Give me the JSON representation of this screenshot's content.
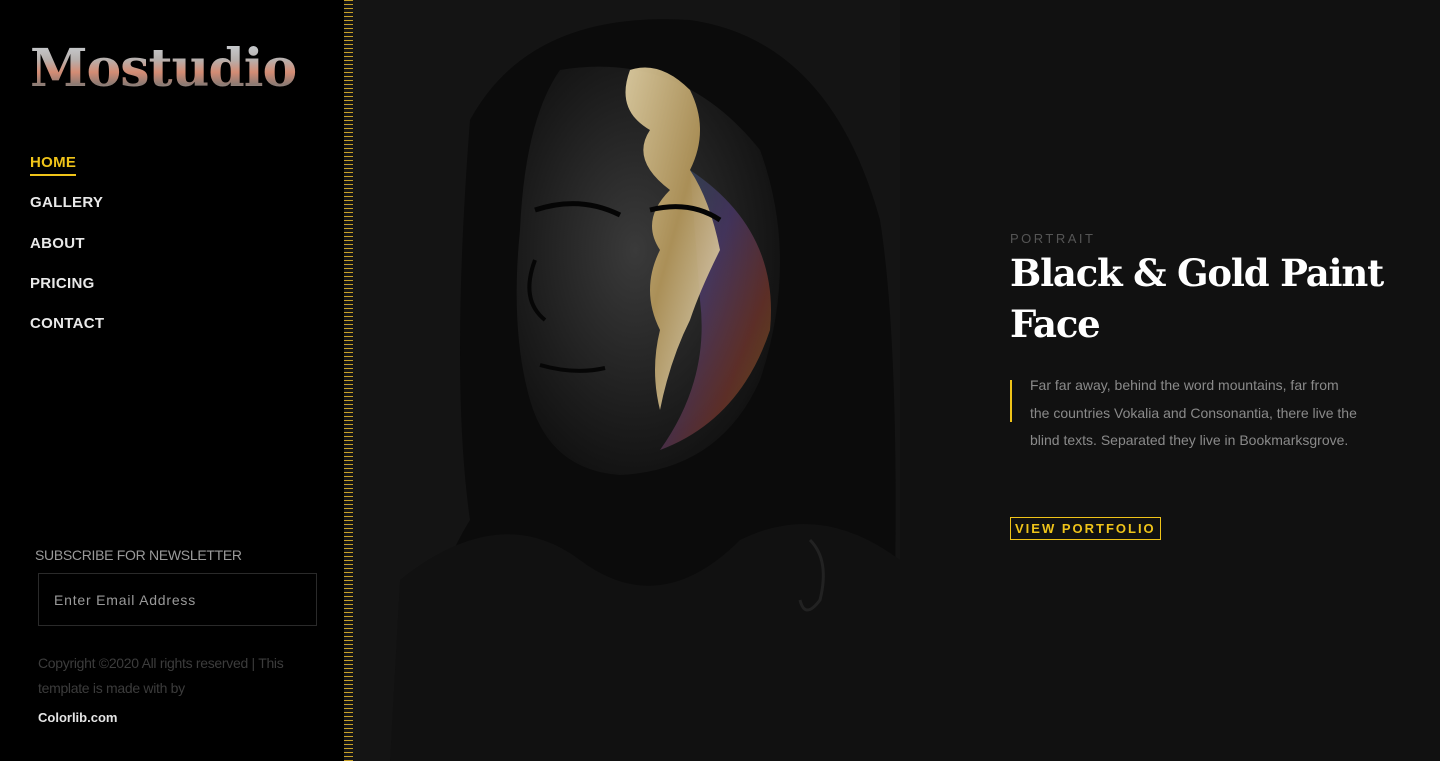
{
  "brand": {
    "logo": "Mostudio"
  },
  "nav": {
    "items": [
      {
        "label": "HOME",
        "active": true
      },
      {
        "label": "GALLERY"
      },
      {
        "label": "ABOUT"
      },
      {
        "label": "PRICING"
      },
      {
        "label": "CONTACT"
      }
    ]
  },
  "newsletter": {
    "heading": "SUBSCRIBE FOR NEWSLETTER",
    "placeholder": "Enter Email Address"
  },
  "footer": {
    "copyright": "Copyright ©2020 All rights reserved | This template is made with by",
    "link": "Colorlib.com"
  },
  "hero": {
    "category": "PORTRAIT",
    "title": "Black & Gold Paint Face",
    "description": "Far far away, behind the word mountains, far from the countries Vokalia and Consonantia, there live the blind texts. Separated they live in Bookmarksgrove.",
    "button": "VIEW PORTFOLIO"
  },
  "colors": {
    "accent": "#f0c419",
    "background": "#111111",
    "sidebar": "#000000"
  }
}
